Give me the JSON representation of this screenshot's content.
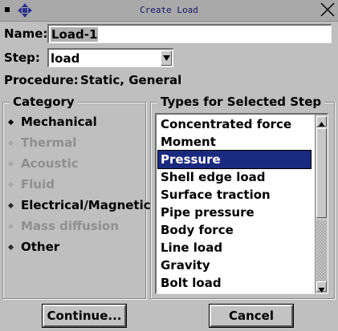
{
  "window": {
    "title": "Create Load"
  },
  "name_field": {
    "label": "Name:",
    "value": "Load-1"
  },
  "step_field": {
    "label": "Step:",
    "value": "load"
  },
  "procedure": {
    "label": "Procedure:",
    "value": "Static, General"
  },
  "category": {
    "title": "Category",
    "options": [
      {
        "label": "Mechanical",
        "selected": true,
        "enabled": true
      },
      {
        "label": "Thermal",
        "selected": false,
        "enabled": false
      },
      {
        "label": "Acoustic",
        "selected": false,
        "enabled": false
      },
      {
        "label": "Fluid",
        "selected": false,
        "enabled": false
      },
      {
        "label": "Electrical/Magnetic",
        "selected": false,
        "enabled": true
      },
      {
        "label": "Mass diffusion",
        "selected": false,
        "enabled": false
      },
      {
        "label": "Other",
        "selected": false,
        "enabled": true
      }
    ]
  },
  "types": {
    "title": "Types for Selected Step",
    "items": [
      "Concentrated force",
      "Moment",
      "Pressure",
      "Shell edge load",
      "Surface traction",
      "Pipe pressure",
      "Body force",
      "Line load",
      "Gravity",
      "Bolt load"
    ],
    "selected": "Pressure"
  },
  "buttons": {
    "continue_label": "Continue...",
    "cancel_label": "Cancel"
  },
  "colors": {
    "selection": "#1a2a7e",
    "background": "#bfbfbf"
  }
}
